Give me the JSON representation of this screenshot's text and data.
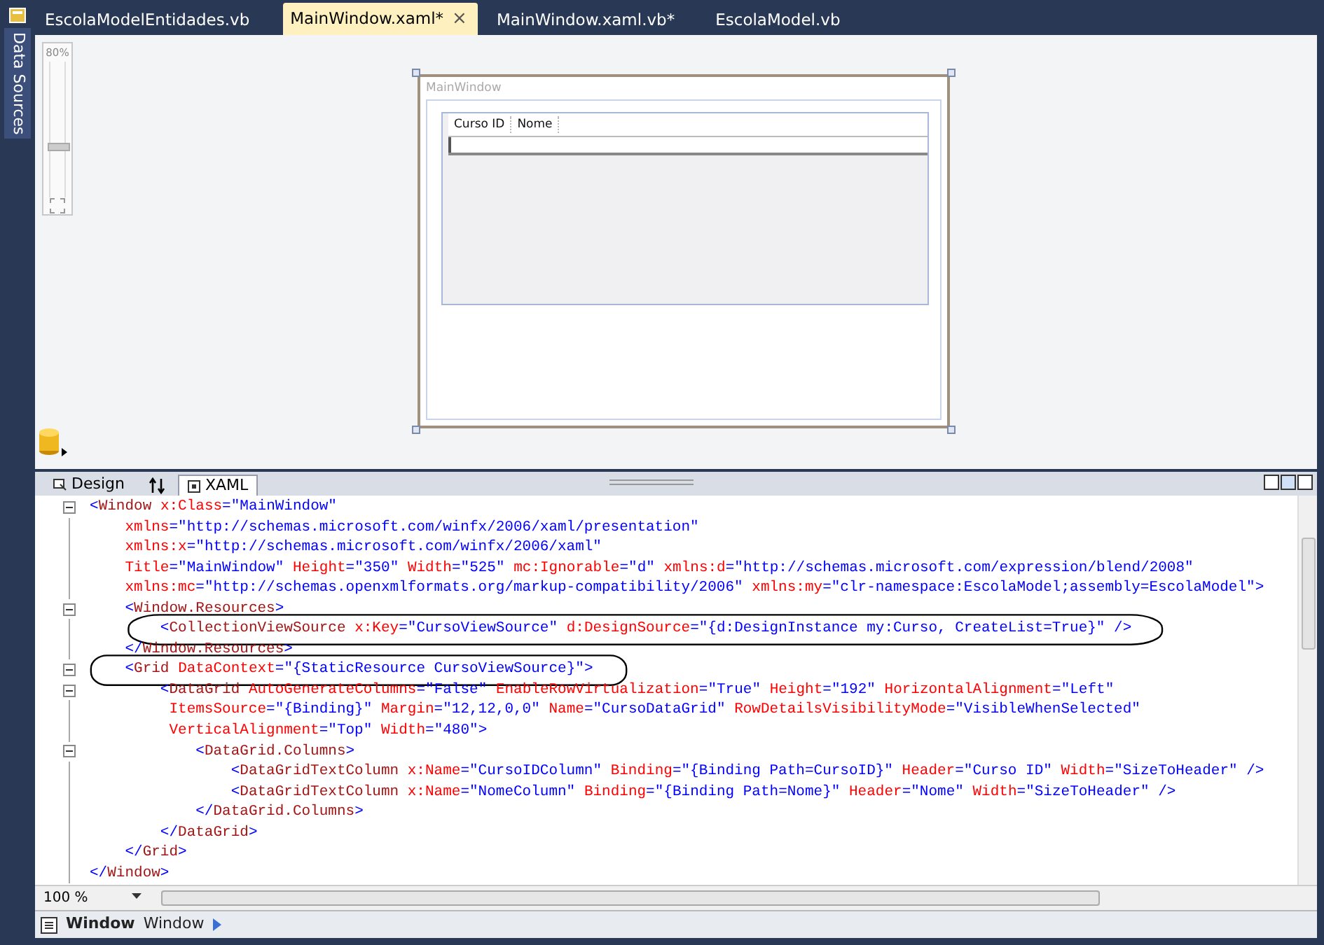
{
  "side_panel": {
    "label": "Data Sources"
  },
  "document_tabs": [
    {
      "label": "EscolaModelEntidades.vb",
      "selected": false
    },
    {
      "label": "MainWindow.xaml*",
      "selected": true,
      "close": "×"
    },
    {
      "label": "MainWindow.xaml.vb*",
      "selected": false
    },
    {
      "label": "EscolaModel.vb",
      "selected": false
    }
  ],
  "designer": {
    "zoom": "80%",
    "zoom_slider": {
      "level": 0.4
    },
    "window": {
      "title": "MainWindow",
      "grid_columns": [
        "Curso ID",
        "Nome"
      ]
    }
  },
  "view_tabs": [
    {
      "kind": "text",
      "label": "Design",
      "selected": false
    },
    {
      "kind": "swap",
      "selected": false
    },
    {
      "kind": "text",
      "label": "XAML",
      "selected": true
    }
  ],
  "code_lines": [
    {
      "text": "<Window x:Class=\"MainWindow\"",
      "fold": true,
      "circled": false
    },
    {
      "text": "    xmlns=\"http://schemas.microsoft.com/winfx/2006/xaml/presentation\"",
      "fold": false,
      "circled": false
    },
    {
      "text": "    xmlns:x=\"http://schemas.microsoft.com/winfx/2006/xaml\"",
      "fold": false,
      "circled": false
    },
    {
      "text": "    Title=\"MainWindow\" Height=\"350\" Width=\"525\" mc:Ignorable=\"d\" xmlns:d=\"http://schemas.microsoft.com/expression/blend/2008\"",
      "fold": false,
      "circled": false
    },
    {
      "text": "    xmlns:mc=\"http://schemas.openxmlformats.org/markup-compatibility/2006\" xmlns:my=\"clr-namespace:EscolaModel;assembly=EscolaModel\">",
      "fold": false,
      "circled": false
    },
    {
      "text": "    <Window.Resources>",
      "fold": true,
      "circled": false
    },
    {
      "text": "        <CollectionViewSource x:Key=\"CursoViewSource\" d:DesignSource=\"{d:DesignInstance my:Curso, CreateList=True}\" />",
      "fold": false,
      "circled": true
    },
    {
      "text": "    </Window.Resources>",
      "fold": false,
      "circled": false
    },
    {
      "text": "    <Grid DataContext=\"{StaticResource CursoViewSource}\">",
      "fold": true,
      "circled": true
    },
    {
      "text": "        <DataGrid AutoGenerateColumns=\"False\" EnableRowVirtualization=\"True\" Height=\"192\" HorizontalAlignment=\"Left\"",
      "fold": true,
      "circled": false
    },
    {
      "text": "         ItemsSource=\"{Binding}\" Margin=\"12,12,0,0\" Name=\"CursoDataGrid\" RowDetailsVisibilityMode=\"VisibleWhenSelected\"",
      "fold": false,
      "circled": false
    },
    {
      "text": "         VerticalAlignment=\"Top\" Width=\"480\">",
      "fold": false,
      "circled": false
    },
    {
      "text": "            <DataGrid.Columns>",
      "fold": true,
      "circled": false
    },
    {
      "text": "                <DataGridTextColumn x:Name=\"CursoIDColumn\" Binding=\"{Binding Path=CursoID}\" Header=\"Curso ID\" Width=\"SizeToHeader\" />",
      "fold": false,
      "circled": false
    },
    {
      "text": "                <DataGridTextColumn x:Name=\"NomeColumn\" Binding=\"{Binding Path=Nome}\" Header=\"Nome\" Width=\"SizeToHeader\" />",
      "fold": false,
      "circled": false
    },
    {
      "text": "            </DataGrid.Columns>",
      "fold": false,
      "circled": false
    },
    {
      "text": "        </DataGrid>",
      "fold": false,
      "circled": false
    },
    {
      "text": "    </Grid>",
      "fold": false,
      "circled": false
    },
    {
      "text": "</Window>",
      "fold": false,
      "circled": false
    }
  ],
  "editor_zoom": "100 %",
  "breadcrumb": [
    {
      "text": "Window",
      "bold": true
    },
    {
      "text": "Window",
      "bold": false
    }
  ]
}
